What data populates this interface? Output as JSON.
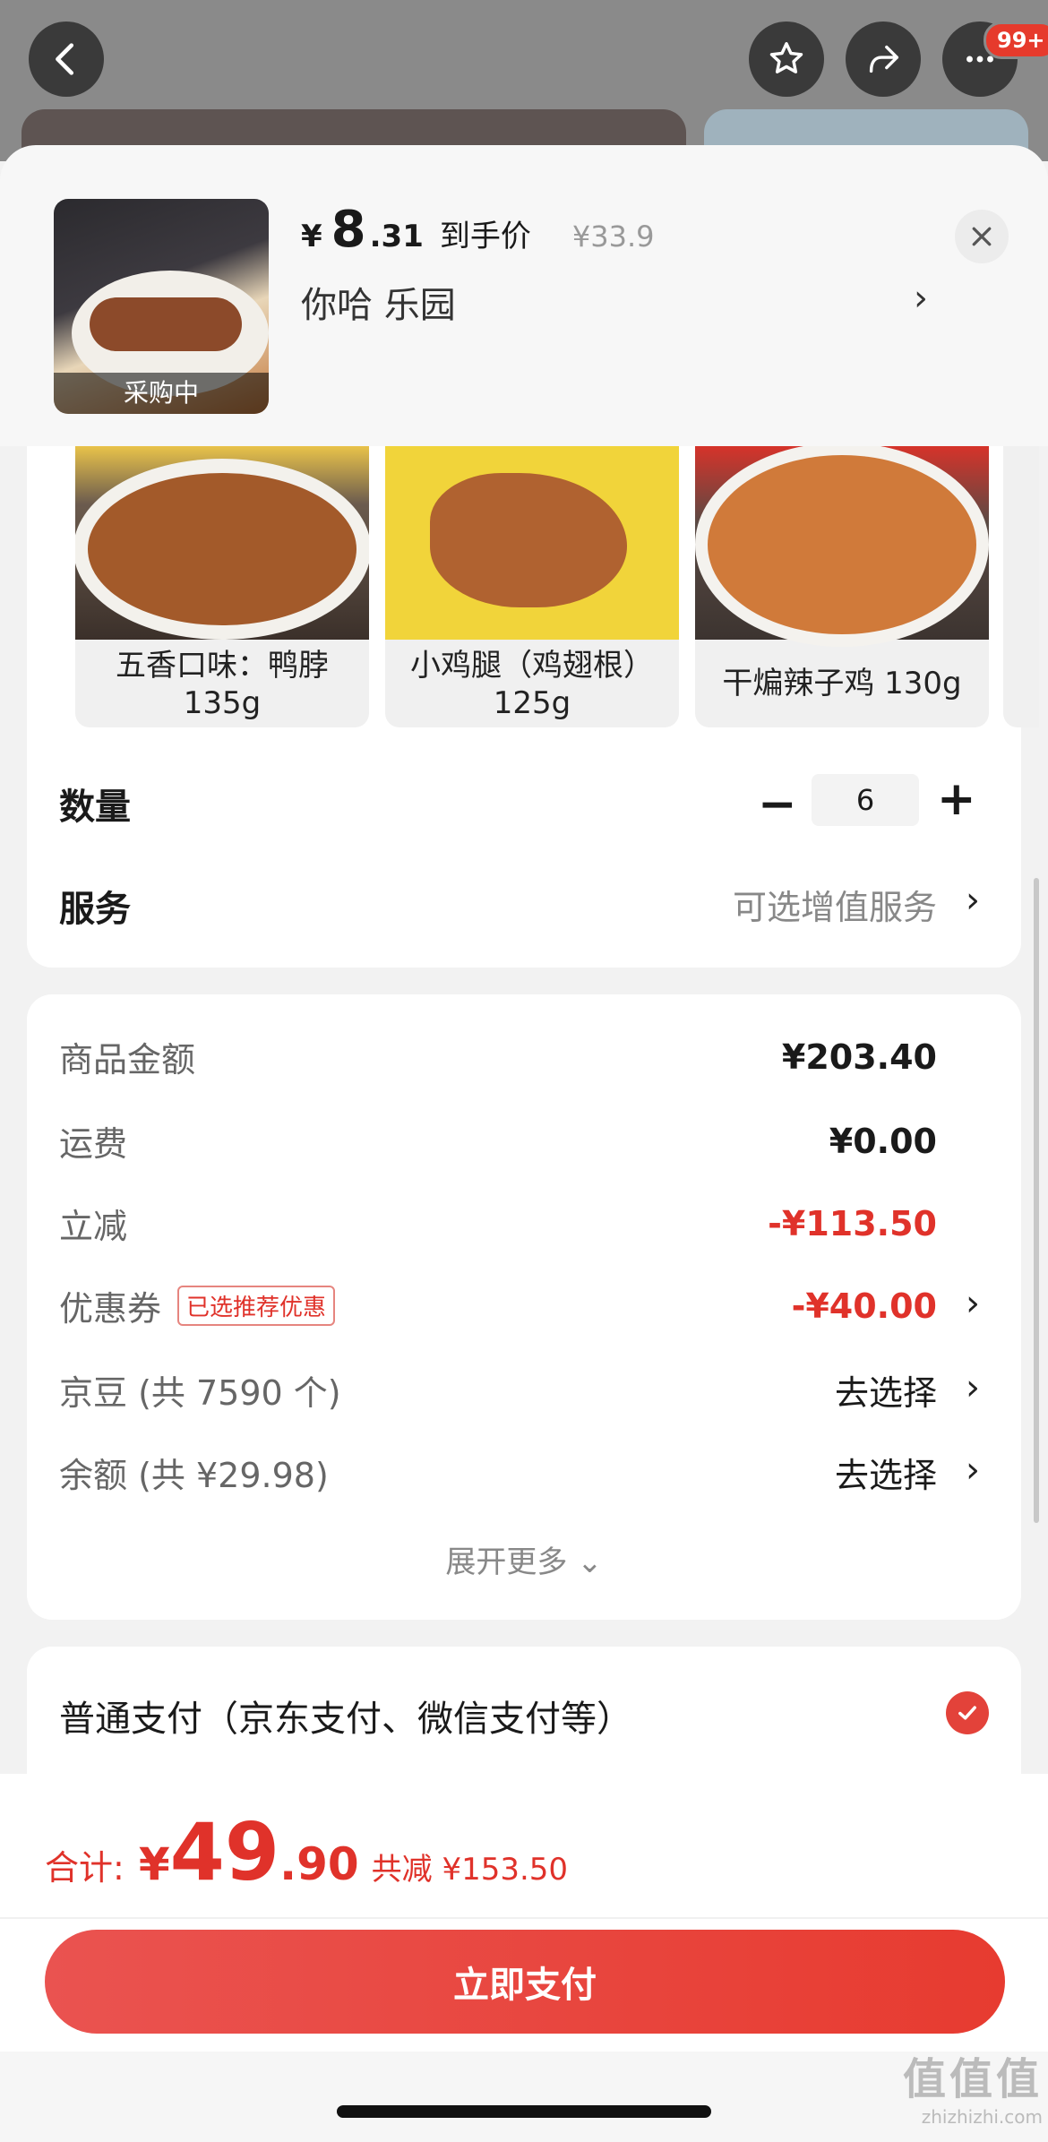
{
  "top_bar": {
    "notification_badge": "99+",
    "icons": [
      "back-icon",
      "star-icon",
      "share-icon",
      "more-icon"
    ]
  },
  "product": {
    "thumb_label": "采购中",
    "price_symbol": "¥",
    "price_int": "8",
    "price_dec": ".31",
    "price_note": "到手价",
    "original_price": "¥33.9",
    "spec": "你哈  乐园",
    "spec_arrow": "›"
  },
  "variants": [
    {
      "label": "五香口味：鸭脖\n135g"
    },
    {
      "label": "小鸡腿（鸡翅根）\n125g"
    },
    {
      "label": "干煸辣子鸡 130g"
    }
  ],
  "quantity": {
    "title": "数量",
    "minus": "−",
    "value": "6",
    "plus": "+"
  },
  "service": {
    "title": "服务",
    "value": "可选增值服务",
    "arrow": "›"
  },
  "price_detail": {
    "goods_label": "商品金额",
    "goods_value": "¥203.40",
    "shipping_label": "运费",
    "shipping_value": "¥0.00",
    "discount_label": "立减",
    "discount_value": "-¥113.50",
    "coupon_label": "优惠券",
    "coupon_tag": "已选推荐优惠",
    "coupon_value": "-¥40.00",
    "beans_label": "京豆 (共 7590 个)",
    "beans_value": "去选择",
    "balance_label": "余额 (共 ¥29.98)",
    "balance_value": "去选择",
    "expand": "展开更多 ⌄",
    "arrow": "›"
  },
  "payment": {
    "method": "普通支付（京东支付、微信支付等）"
  },
  "bottom": {
    "total_label": "合计:",
    "total_symbol": "¥",
    "total_int": "49",
    "total_dec": ".90",
    "total_saved": "共减 ¥153.50",
    "pay_button": "立即支付"
  },
  "watermark": {
    "big": "值值值",
    "small": "zhizhizhi.com"
  },
  "colors": {
    "accent_red": "#e0322a",
    "button_gradient_start": "#ea5350",
    "button_gradient_end": "#e73b30"
  }
}
